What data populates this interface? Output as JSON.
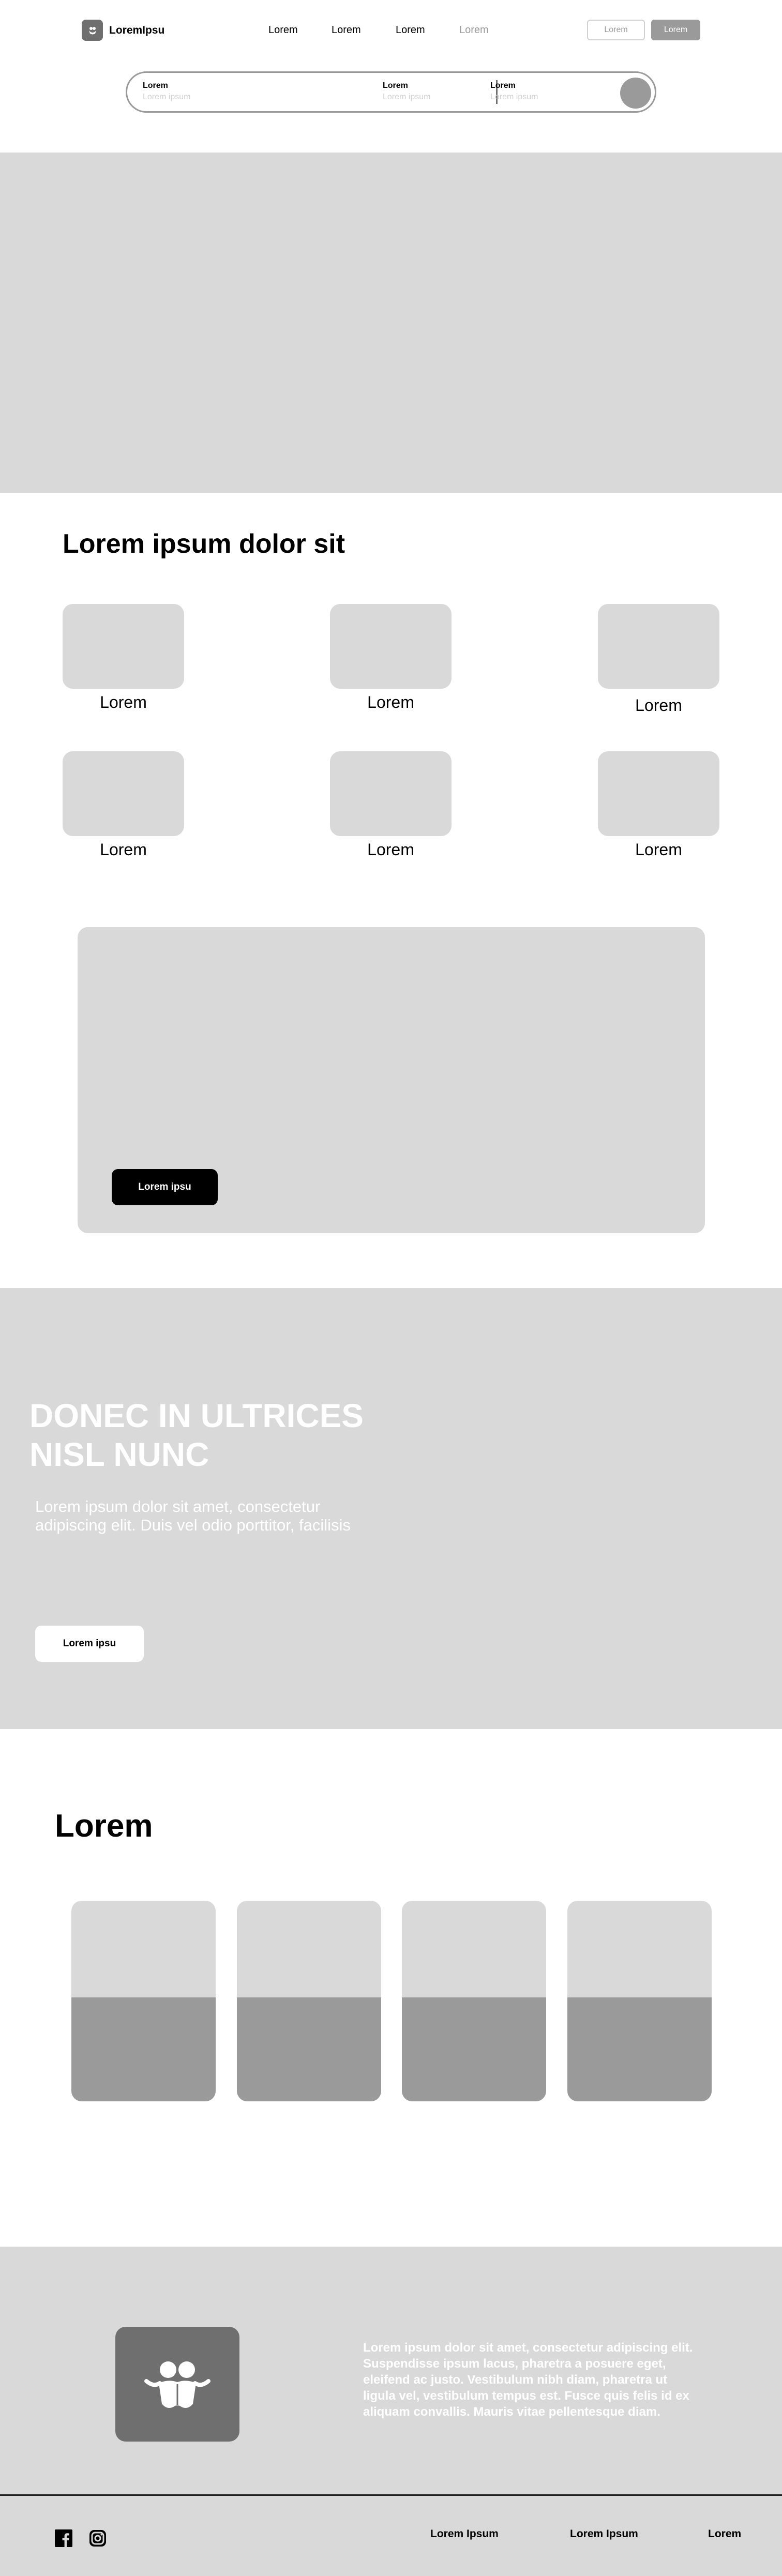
{
  "header": {
    "logo_text": "LoremIpsu",
    "nav": [
      "Lorem",
      "Lorem",
      "Lorem",
      "Lorem"
    ],
    "outline_button": "Lorem",
    "filled_button": "Lorem"
  },
  "search": {
    "fields": [
      {
        "label": "Lorem",
        "placeholder": "Lorem ipsum"
      },
      {
        "label": "Lorem",
        "placeholder": "Lorem ipsum"
      },
      {
        "label": "Lorem",
        "placeholder": "Lorem ipsum"
      }
    ]
  },
  "categories": {
    "title": "Lorem ipsum dolor sit",
    "items": [
      "Lorem",
      "Lorem",
      "Lorem",
      "Lorem",
      "Lorem",
      "Lorem"
    ]
  },
  "promo": {
    "button": "Lorem ipsu"
  },
  "banner": {
    "title": "DONEC IN ULTRICES NISL NUNC",
    "text": "Lorem ipsum dolor sit amet, consectetur adipiscing elit. Duis vel odio porttitor, facilisis",
    "button": "Lorem ipsu"
  },
  "listing": {
    "title": "Lorem"
  },
  "about": {
    "text": "Lorem ipsum dolor sit amet, consectetur adipiscing elit. Suspendisse ipsum lacus, pharetra a posuere eget, eleifend ac justo. Vestibulum nibh diam, pharetra ut ligula vel, vestibulum tempus est. Fusce quis felis id ex aliquam convallis. Mauris vitae pellentesque diam."
  },
  "footer": {
    "links": [
      "Lorem Ipsum",
      "Lorem Ipsum",
      "Lorem"
    ]
  },
  "colors": {
    "placeholder_gray": "#d9d9d9",
    "mid_gray": "#9a9a9a",
    "dark_gray": "#6f6f6f"
  }
}
